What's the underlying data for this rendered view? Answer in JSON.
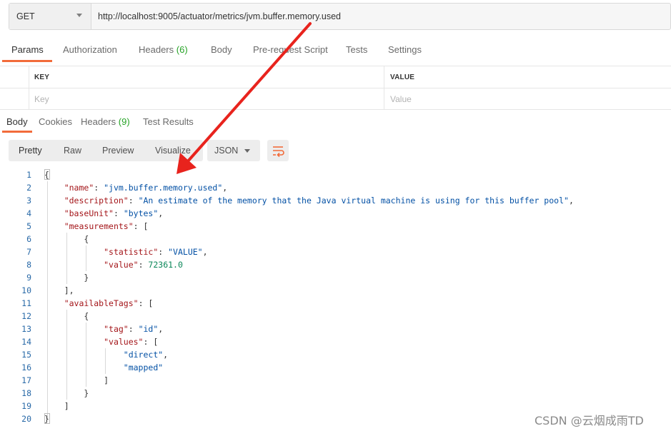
{
  "request": {
    "method": "GET",
    "url": "http://localhost:9005/actuator/metrics/jvm.buffer.memory.used"
  },
  "request_tabs": {
    "params": "Params",
    "authorization": "Authorization",
    "headers": "Headers",
    "headers_count": "(6)",
    "body": "Body",
    "prerequest": "Pre-request Script",
    "tests": "Tests",
    "settings": "Settings"
  },
  "params_table": {
    "key_header": "KEY",
    "value_header": "VALUE",
    "key_placeholder": "Key",
    "value_placeholder": "Value"
  },
  "response_tabs": {
    "body": "Body",
    "cookies": "Cookies",
    "headers": "Headers",
    "headers_count": "(9)",
    "test_results": "Test Results"
  },
  "format_toolbar": {
    "pretty": "Pretty",
    "raw": "Raw",
    "preview": "Preview",
    "visualize": "Visualize",
    "format": "JSON",
    "wrap_icon": "wrap-lines-icon"
  },
  "code": {
    "line_numbers": [
      "1",
      "2",
      "3",
      "4",
      "5",
      "6",
      "7",
      "8",
      "9",
      "10",
      "11",
      "12",
      "13",
      "14",
      "15",
      "16",
      "17",
      "18",
      "19",
      "20"
    ],
    "l1": "{",
    "l2_key": "\"name\"",
    "l2_val": "\"jvm.buffer.memory.used\"",
    "l3_key": "\"description\"",
    "l3_val": "\"An estimate of the memory that the Java virtual machine is using for this buffer pool\"",
    "l4_key": "\"baseUnit\"",
    "l4_val": "\"bytes\"",
    "l5_key": "\"measurements\"",
    "l6": "{",
    "l7_key": "\"statistic\"",
    "l7_val": "\"VALUE\"",
    "l8_key": "\"value\"",
    "l8_val": "72361.0",
    "l9": "}",
    "l10": "],",
    "l11_key": "\"availableTags\"",
    "l12": "{",
    "l13_key": "\"tag\"",
    "l13_val": "\"id\"",
    "l14_key": "\"values\"",
    "l15_val": "\"direct\"",
    "l16_val": "\"mapped\"",
    "l17": "]",
    "l18": "}",
    "l19": "]",
    "l20": "}"
  },
  "annotation": {
    "arrow_color": "#e8231d"
  },
  "watermark": "CSDN @云烟成雨TD",
  "colors": {
    "accent": "#f26b3a",
    "count_green": "#26a326",
    "json_key": "#a4161a",
    "json_string": "#0451a5",
    "json_number": "#098658"
  }
}
